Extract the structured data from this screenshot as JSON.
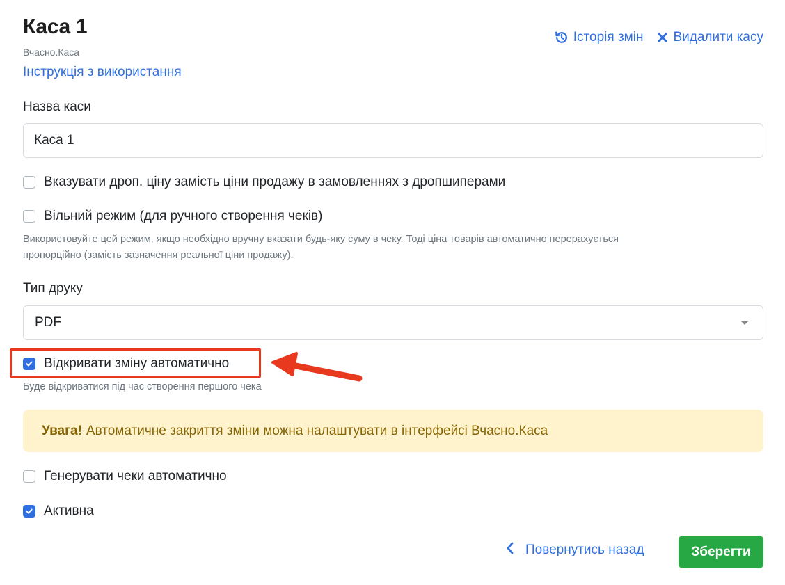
{
  "header": {
    "title": "Каса 1",
    "subtitle": "Вчасно.Каса",
    "instruction_link": "Інструкція з використання"
  },
  "top_actions": {
    "history_label": "Історія змін",
    "delete_label": "Видалити касу"
  },
  "form": {
    "name_label": "Назва каси",
    "name_value": "Каса 1",
    "drop_price": {
      "label": "Вказувати дроп. ціну замість ціни продажу в замовленнях з дропшиперами",
      "checked": false
    },
    "free_mode": {
      "label": "Вільний режим (для ручного створення чеків)",
      "checked": false,
      "hint_line1": "Використовуйте цей режим, якщо необхідно вручну вказати будь-яку суму в чеку. Тоді ціна товарів автоматично перерахується",
      "hint_line2": "пропорційно (замість зазначення реальної ціни продажу)."
    },
    "print_type_label": "Тип друку",
    "print_type_value": "PDF",
    "auto_open_shift": {
      "label": "Відкривати зміну автоматично",
      "checked": true,
      "hint": "Буде відкриватися під час створення першого чека"
    },
    "alert": {
      "strong": "Увага!",
      "text": "Автоматичне закриття зміни можна налаштувати в інтерфейсі Вчасно.Каса"
    },
    "auto_receipts": {
      "label": "Генерувати чеки автоматично",
      "checked": false
    },
    "active": {
      "label": "Активна",
      "checked": true
    }
  },
  "footer": {
    "back_label": "Повернутись назад",
    "save_label": "Зберегти"
  },
  "colors": {
    "link": "#2f6fe0",
    "save": "#28a745",
    "alert_bg": "#fff3cd",
    "alert_text": "#856404",
    "annotation": "#e8391f"
  }
}
